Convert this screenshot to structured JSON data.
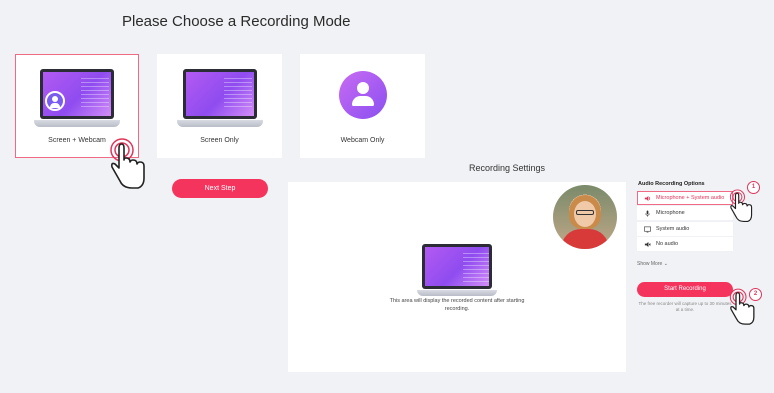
{
  "page": {
    "title": "Please Choose a Recording Mode"
  },
  "modes": [
    {
      "label": "Screen + Webcam",
      "selected": true
    },
    {
      "label": "Screen Only",
      "selected": false
    },
    {
      "label": "Webcam Only",
      "selected": false
    }
  ],
  "next_button": "Next Step",
  "settings": {
    "title": "Recording Settings",
    "preview_text": "This area will display the recorded content after starting recording."
  },
  "audio": {
    "title": "Audio Recording Options",
    "options": [
      {
        "label": "Microphone + System audio",
        "icon": "speaker-icon",
        "selected": true
      },
      {
        "label": "Microphone",
        "icon": "microphone-icon",
        "selected": false
      },
      {
        "label": "System audio",
        "icon": "monitor-audio-icon",
        "selected": false
      },
      {
        "label": "No audio",
        "icon": "mute-icon",
        "selected": false
      }
    ],
    "show_more": "Show More",
    "start_button": "Start Recording",
    "note": "The free recorder will capture up to 30 minutes at a time."
  },
  "badges": [
    "1",
    "2"
  ],
  "colors": {
    "accent": "#f5345e",
    "selected_border": "#f06a85",
    "purple": "#9b55f2"
  }
}
